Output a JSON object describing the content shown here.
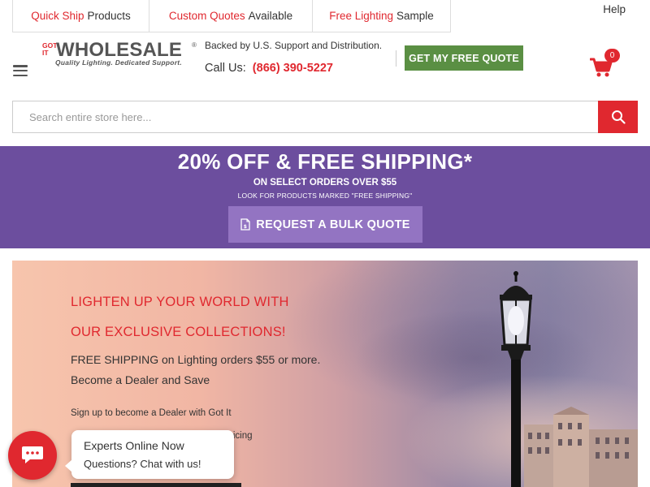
{
  "top_tabs": [
    {
      "highlight": "Quick Ship",
      "rest": "Products"
    },
    {
      "highlight": "Custom Quotes",
      "rest": "Available"
    },
    {
      "highlight": "Free Lighting",
      "rest": "Sample"
    }
  ],
  "help_label": "Help",
  "logo": {
    "got_it": "GOT IT",
    "wordmark": "WHOLESALE",
    "reg": "®",
    "tagline": "Quality Lighting. Dedicated Support."
  },
  "header": {
    "backed_text": "Backed by U.S. Support and Distribution.",
    "call_label": "Call Us:",
    "phone": "(866) 390-5227",
    "quote_button": "GET MY FREE QUOTE",
    "cart_count": "0"
  },
  "search": {
    "placeholder": "Search entire store here..."
  },
  "promo": {
    "title": "20% OFF & FREE SHIPPING*",
    "subtitle": "ON SELECT ORDERS OVER $55",
    "note": "LOOK FOR PRODUCTS MARKED \"FREE SHIPPING\"",
    "bulk_button": "REQUEST A BULK QUOTE"
  },
  "hero": {
    "heading_line1": "LIGHTEN UP YOUR WORLD WITH",
    "heading_line2": "OUR EXCLUSIVE COLLECTIONS!",
    "line1": "FREE SHIPPING on Lighting orders $55 or more.",
    "line2": "Become a Dealer and Save",
    "line3": "Sign up to become a Dealer with Got It",
    "line4_partial": "ricing"
  },
  "chat": {
    "title": "Experts Online Now",
    "subtitle": "Questions? Chat with us!"
  },
  "colors": {
    "brand_red": "#e0282f",
    "promo_purple": "#6c4e9e",
    "bulk_button_purple": "#9374c2",
    "quote_green": "#5a8f43"
  }
}
